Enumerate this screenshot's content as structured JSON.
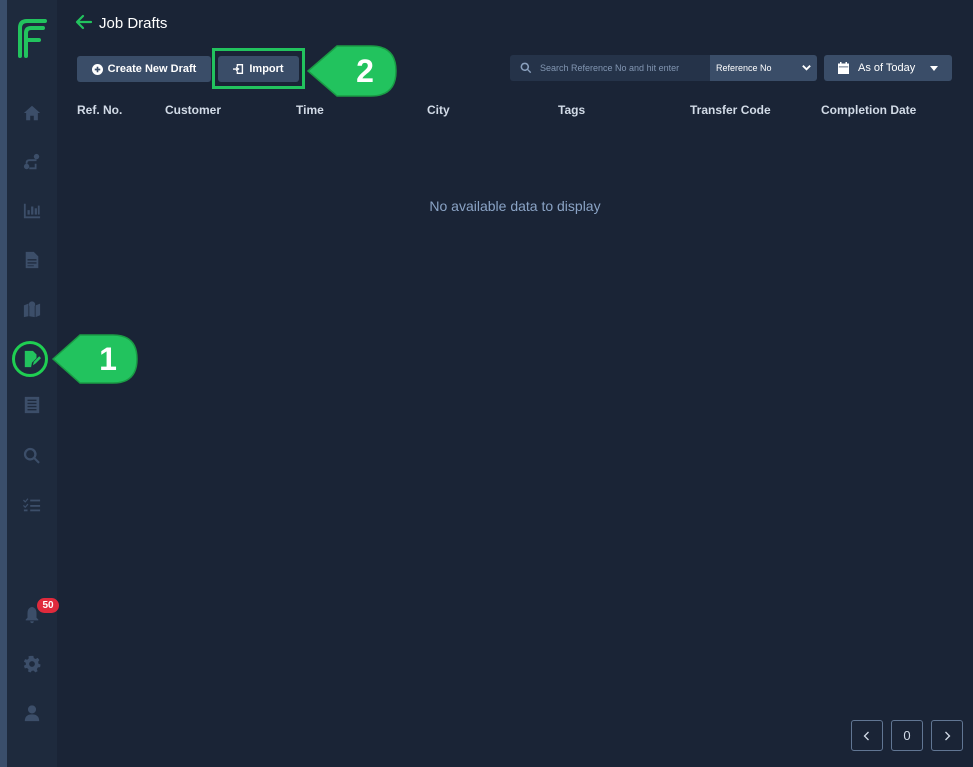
{
  "header": {
    "title": "Job Drafts"
  },
  "toolbar": {
    "create_label": "Create New Draft",
    "import_label": "Import",
    "search_placeholder": "Search Reference No and hit enter",
    "search_field_selected": "Reference No",
    "date_filter_label": "As of Today"
  },
  "table": {
    "columns": [
      "Ref. No.",
      "Customer",
      "Time",
      "City",
      "Tags",
      "Transfer Code",
      "Completion Date"
    ],
    "empty_message": "No available data to display"
  },
  "sidebar": {
    "items": [
      {
        "icon": "home-icon"
      },
      {
        "icon": "route-icon"
      },
      {
        "icon": "analytics-icon"
      },
      {
        "icon": "document-icon"
      },
      {
        "icon": "map-icon"
      },
      {
        "icon": "job-drafts-icon",
        "active": true
      },
      {
        "icon": "list-document-icon"
      },
      {
        "icon": "search-icon"
      },
      {
        "icon": "checklist-icon"
      }
    ],
    "notifications_count": "50",
    "footer": [
      {
        "icon": "bell-icon"
      },
      {
        "icon": "gear-icon"
      },
      {
        "icon": "user-icon"
      }
    ]
  },
  "pagination": {
    "current_page": "0"
  },
  "annotations": {
    "step1": "1",
    "step2": "2"
  },
  "colors": {
    "background": "#1a2436",
    "sidebar": "#1e2a3d",
    "button": "#3a4d68",
    "accent_green": "#22c35e",
    "badge_red": "#e02a3c"
  }
}
